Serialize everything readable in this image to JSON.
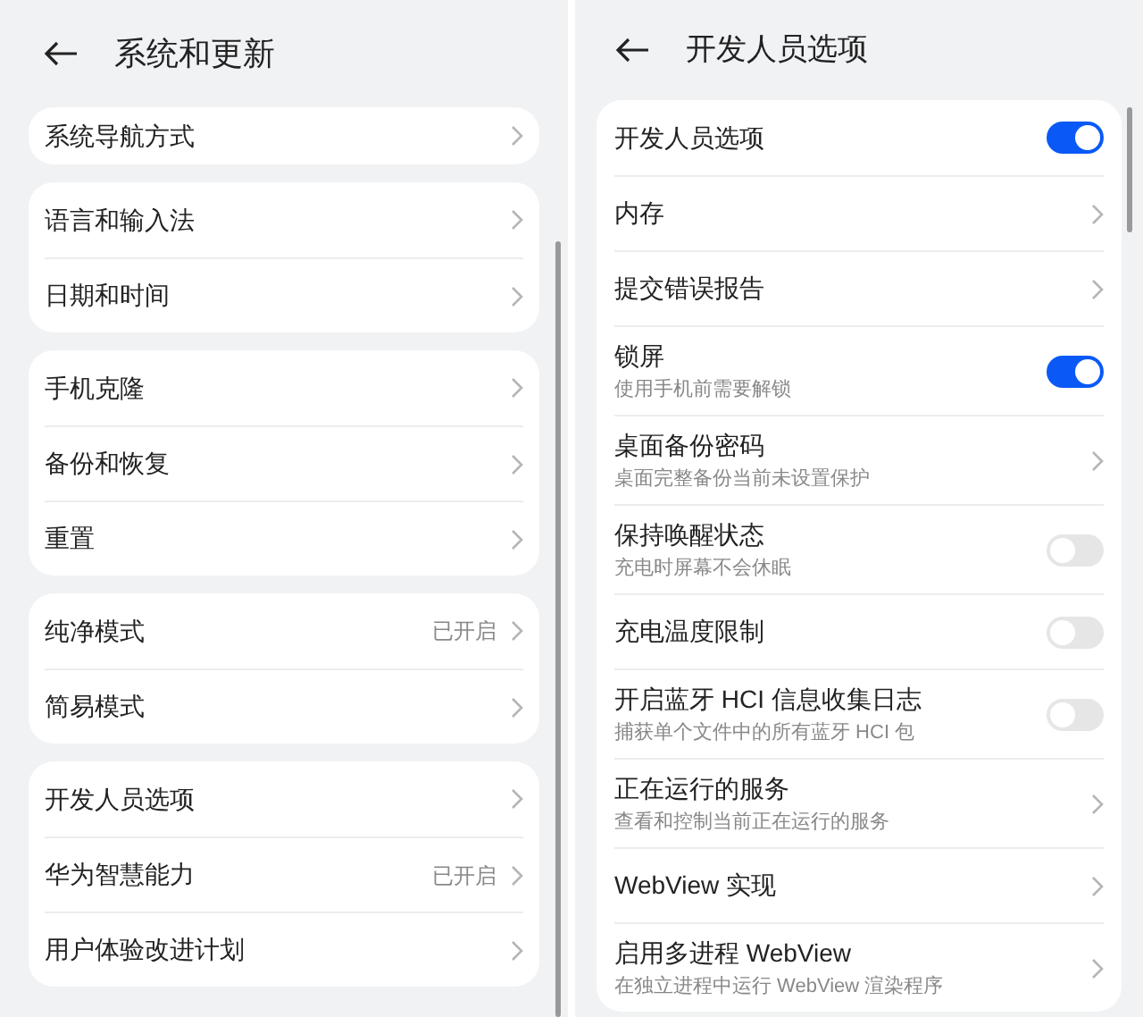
{
  "left_panel": {
    "title": "系统和更新",
    "groups": [
      {
        "items": [
          {
            "label": "系统导航方式"
          }
        ]
      },
      {
        "items": [
          {
            "label": "语言和输入法"
          },
          {
            "label": "日期和时间"
          }
        ]
      },
      {
        "items": [
          {
            "label": "手机克隆"
          },
          {
            "label": "备份和恢复"
          },
          {
            "label": "重置"
          }
        ]
      },
      {
        "items": [
          {
            "label": "纯净模式",
            "value": "已开启"
          },
          {
            "label": "简易模式"
          }
        ]
      },
      {
        "items": [
          {
            "label": "开发人员选项"
          },
          {
            "label": "华为智慧能力",
            "value": "已开启"
          },
          {
            "label": "用户体验改进计划"
          }
        ]
      }
    ]
  },
  "right_panel": {
    "title": "开发人员选项",
    "items": [
      {
        "kind": "switch",
        "label": "开发人员选项",
        "on": true
      },
      {
        "kind": "link",
        "label": "内存"
      },
      {
        "kind": "link",
        "label": "提交错误报告"
      },
      {
        "kind": "switch",
        "label": "锁屏",
        "subtitle": "使用手机前需要解锁",
        "on": true
      },
      {
        "kind": "link",
        "label": "桌面备份密码",
        "subtitle": "桌面完整备份当前未设置保护"
      },
      {
        "kind": "switch",
        "label": "保持唤醒状态",
        "subtitle": "充电时屏幕不会休眠",
        "on": false
      },
      {
        "kind": "switch",
        "label": "充电温度限制",
        "on": false
      },
      {
        "kind": "switch",
        "label": "开启蓝牙 HCI 信息收集日志",
        "subtitle": "捕获单个文件中的所有蓝牙 HCI 包",
        "on": false
      },
      {
        "kind": "link",
        "label": "正在运行的服务",
        "subtitle": "查看和控制当前正在运行的服务"
      },
      {
        "kind": "link",
        "label": "WebView 实现"
      },
      {
        "kind": "link",
        "label": "启用多进程 WebView",
        "subtitle": "在独立进程中运行 WebView 渲染程序"
      }
    ]
  }
}
